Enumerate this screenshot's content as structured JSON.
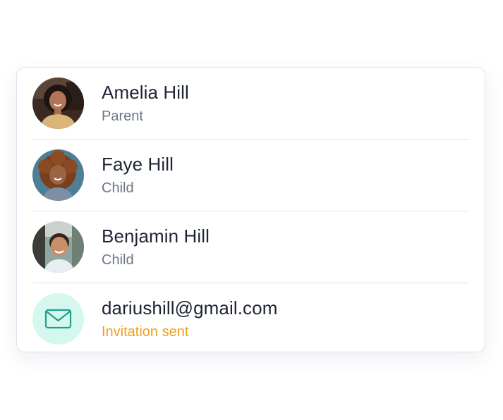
{
  "members": [
    {
      "name": "Amelia Hill",
      "role": "Parent",
      "avatar": "photo-amelia"
    },
    {
      "name": "Faye Hill",
      "role": "Child",
      "avatar": "photo-faye"
    },
    {
      "name": "Benjamin Hill",
      "role": "Child",
      "avatar": "photo-benjamin"
    }
  ],
  "invite": {
    "email": "dariushill@gmail.com",
    "status": "Invitation sent",
    "icon": "mail-icon",
    "icon_bg": "#d5f7ee",
    "icon_color": "#1f9e8e",
    "status_color": "#f0a01a"
  }
}
